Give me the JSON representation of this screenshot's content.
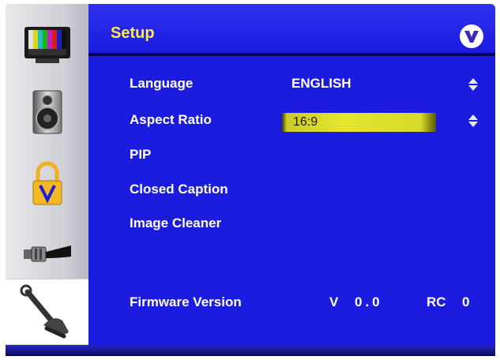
{
  "header": {
    "title": "Setup",
    "logo_icon": "vizio-v-logo"
  },
  "sidebar": {
    "items": [
      {
        "icon": "tv-color-bars-icon",
        "label": "Picture"
      },
      {
        "icon": "speaker-icon",
        "label": "Audio"
      },
      {
        "icon": "parental-lock-icon",
        "label": "Parental"
      },
      {
        "icon": "cable-connector-icon",
        "label": "Input"
      },
      {
        "icon": "wrench-tools-icon",
        "label": "Setup",
        "selected": true
      }
    ]
  },
  "menu": {
    "language_label": "Language",
    "language_value": "ENGLISH",
    "aspect_label": "Aspect Ratio",
    "aspect_value": "16:9",
    "pip_label": "PIP",
    "cc_label": "Closed Caption",
    "image_cleaner_label": "Image Cleaner",
    "firmware_label": "Firmware Version",
    "firmware_v": "V",
    "firmware_num": "0.0",
    "firmware_rc": "RC",
    "firmware_rc_num": "0"
  },
  "colors": {
    "background": "#1c1ce0",
    "title": "#ffe84a",
    "highlight": "#e6e62e",
    "text": "#ffffff"
  }
}
